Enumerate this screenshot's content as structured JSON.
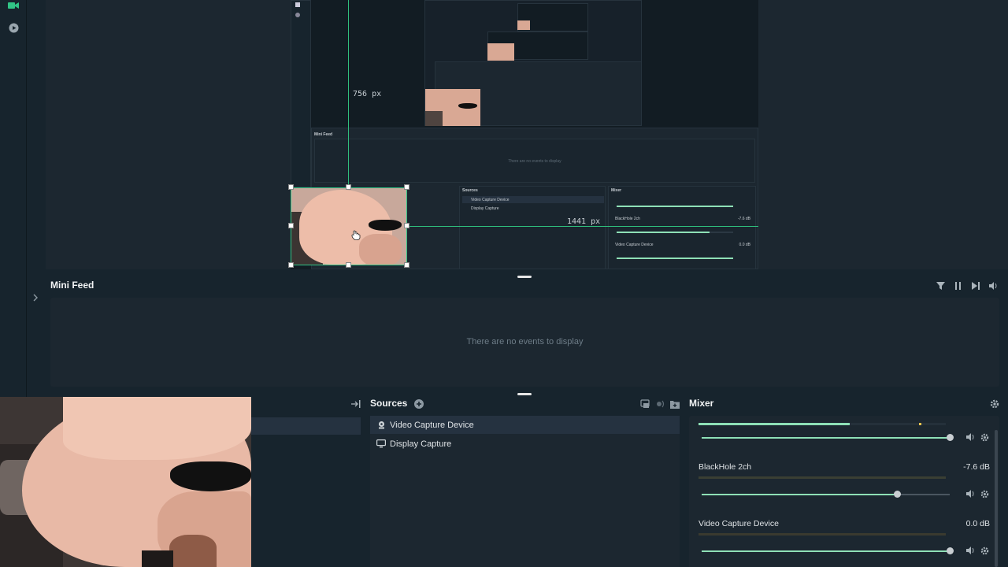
{
  "preview": {
    "guide_vertical_label": "756 px",
    "guide_horizontal_label": "1441 px",
    "nested": {
      "minifeed_title": "Mini Feed",
      "minifeed_empty": "There are no events to display",
      "sources_title": "Sources",
      "source_1": "Video Capture Device",
      "source_2": "Display Capture",
      "mixer_title": "Mixer",
      "mixer_1_name": "BlackHole 2ch",
      "mixer_1_db": "-7.6 dB",
      "mixer_2_name": "Video Capture Device",
      "mixer_2_db": "0.0 dB"
    }
  },
  "minifeed": {
    "title": "Mini Feed",
    "empty_text": "There are no events to display"
  },
  "sources": {
    "title": "Sources",
    "items": [
      {
        "label": "Video Capture Device",
        "icon": "camera-icon",
        "selected": true
      },
      {
        "label": "Display Capture",
        "icon": "monitor-icon",
        "selected": false
      }
    ]
  },
  "mixer": {
    "title": "Mixer",
    "channels": [
      {
        "name": "",
        "db": "",
        "level": 1.0
      },
      {
        "name": "BlackHole 2ch",
        "db": "-7.6 dB",
        "level": 0.79
      },
      {
        "name": "Video Capture Device",
        "db": "0.0 dB",
        "level": 1.0
      }
    ]
  },
  "colors": {
    "accent": "#31c486",
    "slider": "#8ee0b6",
    "panel": "#1c2730",
    "background": "#17242d"
  }
}
